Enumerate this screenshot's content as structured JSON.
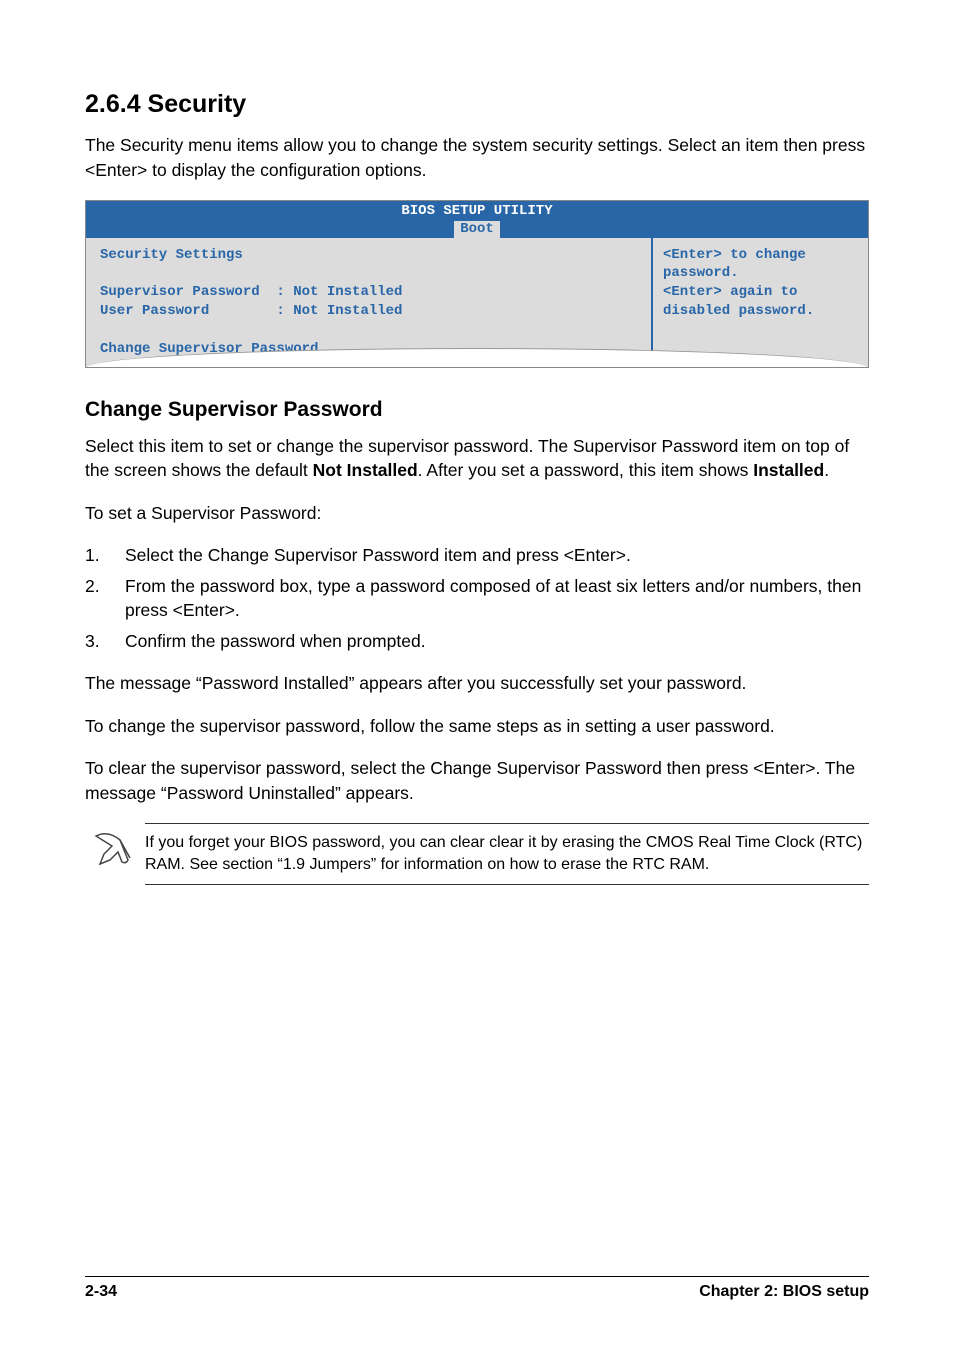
{
  "heading": "2.6.4   Security",
  "intro": "The Security menu items allow you to change the system security settings. Select an item then press <Enter> to display the configuration options.",
  "bios": {
    "title": "BIOS SETUP UTILITY",
    "tab": "Boot",
    "left_lines": {
      "l0": "Security Settings",
      "l1": "",
      "l2": "Supervisor Password  : Not Installed",
      "l3": "User Password        : Not Installed",
      "l4": "",
      "l5": "Change Supervisor Password"
    },
    "right": "<Enter> to change password.\n<Enter> again to disabled password."
  },
  "subheading": "Change Supervisor Password",
  "para1_pre": "Select this item to set or change the supervisor password. The Supervisor Password item on top of the screen shows the default ",
  "para1_bold1": "Not Installed",
  "para1_mid": ". After you set a password, this item shows ",
  "para1_bold2": "Installed",
  "para1_end": ".",
  "para2": "To set a Supervisor Password:",
  "steps": [
    {
      "n": "1.",
      "t": "Select the Change Supervisor Password item and press <Enter>."
    },
    {
      "n": "2.",
      "t": "From the password box, type a password composed of at least six letters and/or numbers, then press <Enter>."
    },
    {
      "n": "3.",
      "t": "Confirm the password when prompted."
    }
  ],
  "para3": "The message “Password Installed” appears after you successfully set your password.",
  "para4": "To change the supervisor password, follow the same steps as in setting a user password.",
  "para5": "To clear the supervisor password, select the Change Supervisor Password then press <Enter>. The message “Password Uninstalled” appears.",
  "note": "If you forget your BIOS password, you can clear clear it by erasing the CMOS Real Time Clock (RTC) RAM. See section “1.9  Jumpers” for information on how to erase the RTC RAM.",
  "footer_left": "2-34",
  "footer_right": "Chapter 2: BIOS setup"
}
